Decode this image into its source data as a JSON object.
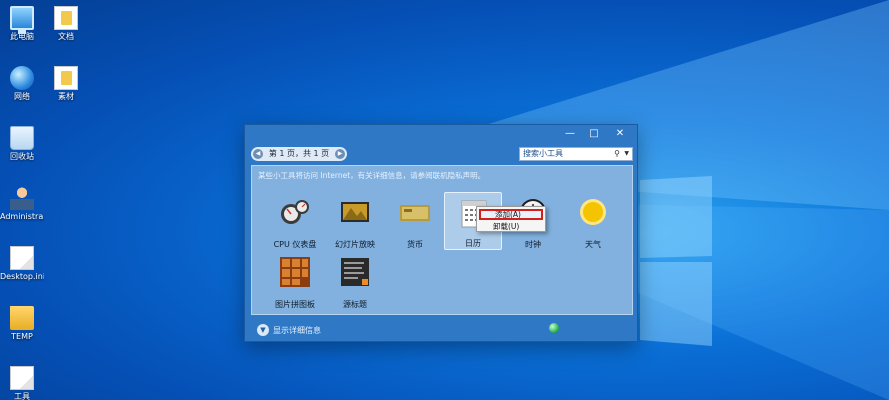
{
  "desktop": {
    "icons": [
      {
        "label": "此电脑",
        "icon": "computer-icon"
      },
      {
        "label": "文档",
        "icon": "documents-icon"
      },
      {
        "label": "网络",
        "icon": "network-icon"
      },
      {
        "label": "素材",
        "icon": "folder-icon"
      },
      {
        "label": "回收站",
        "icon": "recycle-bin-icon"
      },
      {
        "label": "Administra...",
        "icon": "user-folder-icon"
      },
      {
        "label": "Desktop.ini",
        "icon": "file-icon"
      },
      {
        "label": "TEMP",
        "icon": "folder-icon"
      },
      {
        "label": "工具",
        "icon": "file-icon"
      }
    ]
  },
  "gadget_window": {
    "pager": "第 1 页，共 1 页",
    "search_placeholder": "搜索小工具",
    "notice": "某些小工具将访问 Internet，有关详细信息，请参阅联机隐私声明。",
    "gadgets": [
      {
        "label": "CPU 仪表盘",
        "icon": "cpu-meter-icon"
      },
      {
        "label": "幻灯片放映",
        "icon": "slideshow-icon"
      },
      {
        "label": "货币",
        "icon": "currency-icon"
      },
      {
        "label": "日历",
        "icon": "calendar-icon",
        "selected": true
      },
      {
        "label": "时钟",
        "icon": "clock-icon"
      },
      {
        "label": "天气",
        "icon": "weather-icon"
      },
      {
        "label": "图片拼图板",
        "icon": "picture-puzzle-icon"
      },
      {
        "label": "源标题",
        "icon": "feed-headlines-icon"
      }
    ],
    "details_label": "显示详细信息",
    "context_menu": {
      "add": "添加(A)",
      "uninstall": "卸载(U)"
    },
    "controls": {
      "minimize": "—",
      "maximize": "□",
      "close": "✕"
    }
  }
}
